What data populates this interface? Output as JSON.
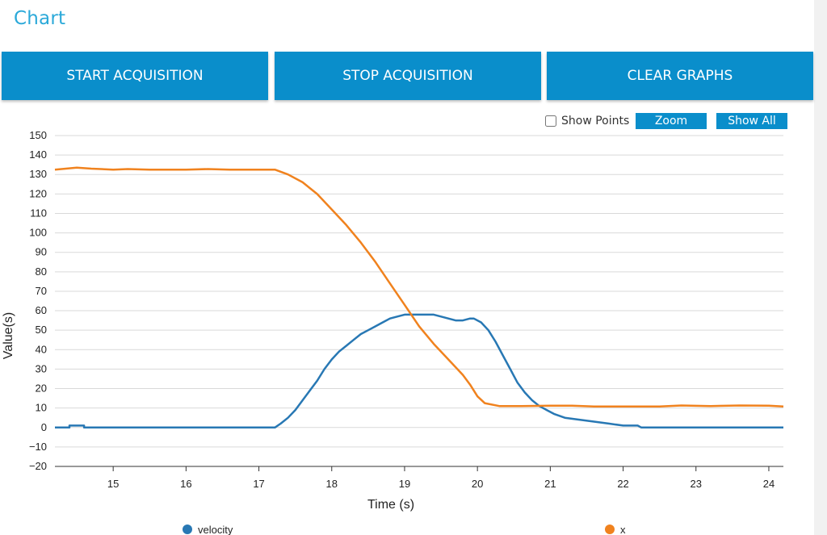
{
  "page": {
    "title": "Chart"
  },
  "buttons": {
    "start": "START ACQUISITION",
    "stop": "STOP ACQUISITION",
    "clear": "CLEAR GRAPHS"
  },
  "options": {
    "show_points_label": "Show Points",
    "show_points_checked": false,
    "zoom_label": "Zoom",
    "show_all_label": "Show All"
  },
  "colors": {
    "accent": "#0a8ecb",
    "title": "#2ba9d9",
    "velocity": "#2878b4",
    "x": "#f0821e",
    "grid": "#d9d9d9"
  },
  "chart_data": {
    "type": "line",
    "title": "",
    "xlabel": "Time (s)",
    "ylabel": "Value(s)",
    "xlim": [
      14.2,
      24.2
    ],
    "ylim": [
      -20,
      150
    ],
    "x_ticks": [
      15,
      16,
      17,
      18,
      19,
      20,
      21,
      22,
      23,
      24
    ],
    "y_ticks": [
      -20,
      -10,
      0,
      10,
      20,
      30,
      40,
      50,
      60,
      70,
      80,
      90,
      100,
      110,
      120,
      130,
      140,
      150
    ],
    "grid": true,
    "legend_position": "bottom",
    "series": [
      {
        "name": "velocity",
        "color": "#2878b4",
        "points": [
          [
            14.2,
            0
          ],
          [
            14.4,
            0
          ],
          [
            14.4,
            1
          ],
          [
            14.6,
            1
          ],
          [
            14.6,
            0
          ],
          [
            15.0,
            0
          ],
          [
            16.0,
            0
          ],
          [
            17.0,
            0
          ],
          [
            17.22,
            0
          ],
          [
            17.3,
            2
          ],
          [
            17.4,
            5
          ],
          [
            17.5,
            9
          ],
          [
            17.6,
            14
          ],
          [
            17.7,
            19
          ],
          [
            17.8,
            24
          ],
          [
            17.9,
            30
          ],
          [
            18.0,
            35
          ],
          [
            18.1,
            39
          ],
          [
            18.2,
            42
          ],
          [
            18.3,
            45
          ],
          [
            18.4,
            48
          ],
          [
            18.5,
            50
          ],
          [
            18.6,
            52
          ],
          [
            18.7,
            54
          ],
          [
            18.8,
            56
          ],
          [
            18.9,
            57
          ],
          [
            19.0,
            58
          ],
          [
            19.1,
            58
          ],
          [
            19.2,
            58
          ],
          [
            19.3,
            58
          ],
          [
            19.4,
            58
          ],
          [
            19.5,
            57
          ],
          [
            19.6,
            56
          ],
          [
            19.7,
            55
          ],
          [
            19.8,
            55
          ],
          [
            19.9,
            56
          ],
          [
            19.95,
            56
          ],
          [
            20.05,
            54
          ],
          [
            20.15,
            50
          ],
          [
            20.25,
            44
          ],
          [
            20.35,
            37
          ],
          [
            20.45,
            30
          ],
          [
            20.55,
            23
          ],
          [
            20.65,
            18
          ],
          [
            20.75,
            14
          ],
          [
            20.85,
            11
          ],
          [
            20.95,
            9
          ],
          [
            21.05,
            7
          ],
          [
            21.2,
            5
          ],
          [
            21.4,
            4
          ],
          [
            21.6,
            3
          ],
          [
            21.8,
            2
          ],
          [
            22.0,
            1
          ],
          [
            22.2,
            1
          ],
          [
            22.25,
            0
          ],
          [
            23.0,
            0
          ],
          [
            24.2,
            0
          ]
        ]
      },
      {
        "name": "x",
        "color": "#f0821e",
        "points": [
          [
            14.2,
            132.5
          ],
          [
            14.5,
            133.5
          ],
          [
            14.7,
            133
          ],
          [
            15.0,
            132.5
          ],
          [
            15.2,
            132.8
          ],
          [
            15.5,
            132.5
          ],
          [
            16.0,
            132.5
          ],
          [
            16.3,
            132.8
          ],
          [
            16.6,
            132.5
          ],
          [
            17.0,
            132.5
          ],
          [
            17.22,
            132.5
          ],
          [
            17.4,
            130
          ],
          [
            17.6,
            126
          ],
          [
            17.8,
            120
          ],
          [
            18.0,
            112
          ],
          [
            18.2,
            104
          ],
          [
            18.4,
            95
          ],
          [
            18.6,
            85
          ],
          [
            18.8,
            74
          ],
          [
            19.0,
            63
          ],
          [
            19.2,
            52
          ],
          [
            19.4,
            43
          ],
          [
            19.6,
            35
          ],
          [
            19.8,
            27
          ],
          [
            19.9,
            22
          ],
          [
            20.0,
            16
          ],
          [
            20.1,
            12.5
          ],
          [
            20.3,
            11
          ],
          [
            20.6,
            11
          ],
          [
            21.0,
            11.2
          ],
          [
            21.3,
            11.2
          ],
          [
            21.6,
            10.8
          ],
          [
            22.0,
            10.8
          ],
          [
            22.5,
            10.8
          ],
          [
            22.8,
            11.3
          ],
          [
            23.2,
            11
          ],
          [
            23.6,
            11.3
          ],
          [
            24.0,
            11.2
          ],
          [
            24.2,
            10.8
          ]
        ]
      }
    ]
  }
}
